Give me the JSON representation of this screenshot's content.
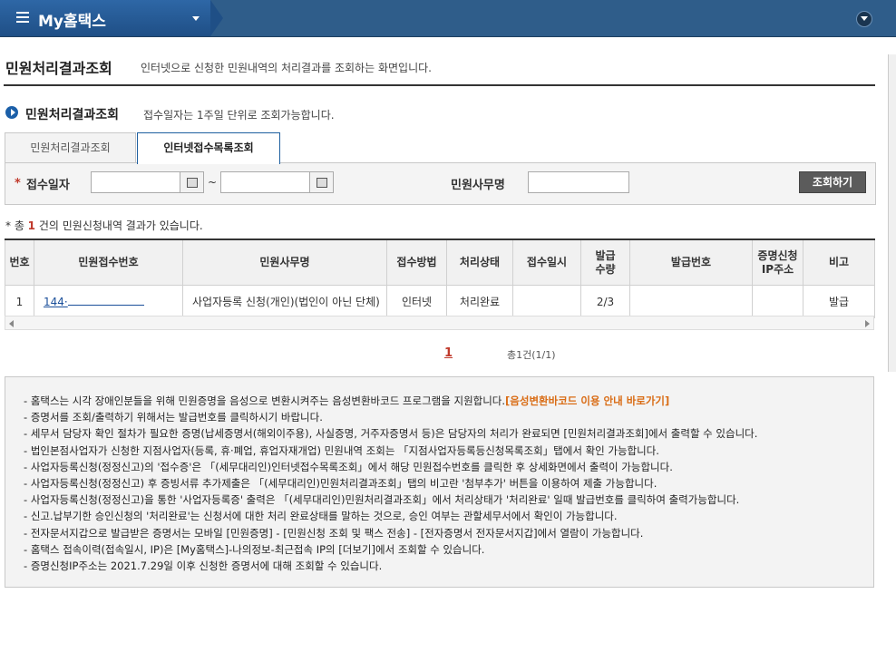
{
  "topbar": {
    "title": "My홈택스"
  },
  "page": {
    "title": "민원처리결과조회",
    "desc": "인터넷으로 신청한 민원내역의 처리결과를 조회하는 화면입니다."
  },
  "section": {
    "title": "민원처리결과조회",
    "desc": "접수일자는 1주일 단위로 조회가능합니다."
  },
  "tabs": [
    {
      "label": "민원처리결과조회",
      "active": false
    },
    {
      "label": "인터넷접수목록조회",
      "active": true
    }
  ],
  "search": {
    "date_label": "접수일자",
    "tilde": "~",
    "office_label": "민원사무명",
    "button": "조회하기"
  },
  "result": {
    "prefix": "* 총 ",
    "count": "1",
    "suffix": " 건의 민원신청내역 결과가 있습니다."
  },
  "table": {
    "headers": [
      "번호",
      "민원접수번호",
      "민원사무명",
      "접수방법",
      "처리상태",
      "접수일시",
      "발급\n수량",
      "발급번호",
      "증명신청\nIP주소",
      "비고"
    ],
    "rows": [
      [
        "1",
        "144·",
        "사업자등록 신청(개인)(법인이 아닌 단체)",
        "인터넷",
        "처리완료",
        "",
        "2/3",
        "",
        "",
        "발급"
      ]
    ]
  },
  "paging": {
    "current": "1",
    "total": "총1건(1/1)"
  },
  "notices": [
    {
      "text": "홈택스는 시각 장애인분들을 위해 민원증명을 음성으로 변환시켜주는 음성변환바코드 프로그램을 지원합니다.",
      "link": "[음성변환바코드 이용 안내 바로가기]"
    },
    {
      "text": "증명서를 조회/출력하기 위해서는 발급번호를 클릭하시기 바랍니다."
    },
    {
      "text": "세무서 담당자 확인 절차가 필요한 증명(납세증명서(해외이주용), 사실증명, 거주자증명서 등)은 담당자의 처리가 완료되면 [민원처리결과조회]에서 출력할 수 있습니다."
    },
    {
      "text": "법인본점사업자가 신청한 지점사업자(등록, 휴·폐업, 휴업자재개업) 민원내역 조회는 「지점사업자등록등신청목록조회」탭에서 확인 가능합니다."
    },
    {
      "text": "사업자등록신청(정정신고)의 '접수증'은 「(세무대리인)인터넷접수목록조회」에서 해당 민원접수번호를 클릭한 후 상세화면에서 출력이 가능합니다."
    },
    {
      "text": "사업자등록신청(정정신고) 후 증빙서류 추가제출은 「(세무대리인)민원처리결과조회」탭의 비고란 '첨부추가' 버튼을 이용하여 제출 가능합니다."
    },
    {
      "text": "사업자등록신청(정정신고)을 통한 '사업자등록증' 출력은 「(세무대리인)민원처리결과조회」에서 처리상태가 '처리완료' 일때 발급번호를 클릭하여 출력가능합니다."
    },
    {
      "text": "신고.납부기한 승인신청의 '처리완료'는 신청서에 대한 처리 완료상태를 말하는 것으로, 승인 여부는 관할세무서에서 확인이 가능합니다."
    },
    {
      "text": "전자문서지갑으로 발급받은 증명서는 모바일 [민원증명] - [민원신청 조회 및 팩스 전송] - [전자증명서 전자문서지갑]에서 열람이 가능합니다."
    },
    {
      "text": "홈택스 접속이력(접속일시, IP)은 [My홈택스]-나의정보-최근접속 IP의 [더보기]에서 조회할 수 있습니다."
    },
    {
      "text": "증명신청IP주소는 2021.7.29일 이후 신청한 증명서에 대해 조회할 수 있습니다."
    }
  ]
}
